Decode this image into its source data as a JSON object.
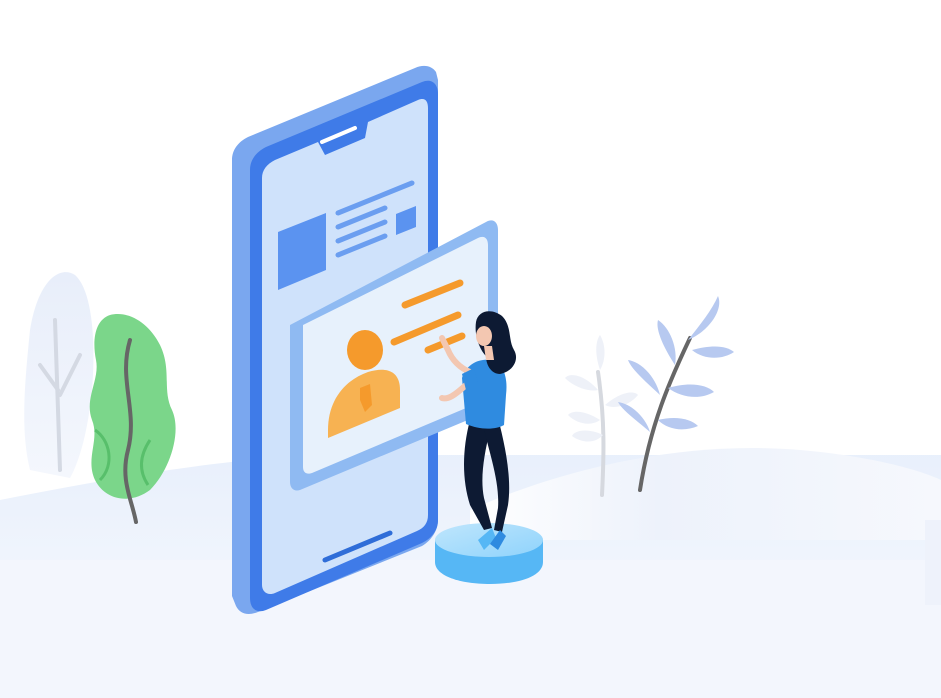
{
  "illustration": {
    "subject": "",
    "colors": {
      "phone_frame": "#5b93f0",
      "phone_edge": "#3f7be8",
      "phone_screen": "#cfe2fb",
      "card_frame": "#8fbaf2",
      "card_inner": "#e7f1fc",
      "accent_orange": "#f59a2c",
      "accent_orange_light": "#f7b252",
      "plant_green": "#7bd68a",
      "plant_green_dark": "#58bf6b",
      "plant_blue": "#b7c9f0",
      "stem_gray": "#666666",
      "woman_shirt": "#2f8be0",
      "woman_pants": "#0d1a33",
      "pedestal": "#56b7f5",
      "ground": "#eef3fc"
    }
  }
}
